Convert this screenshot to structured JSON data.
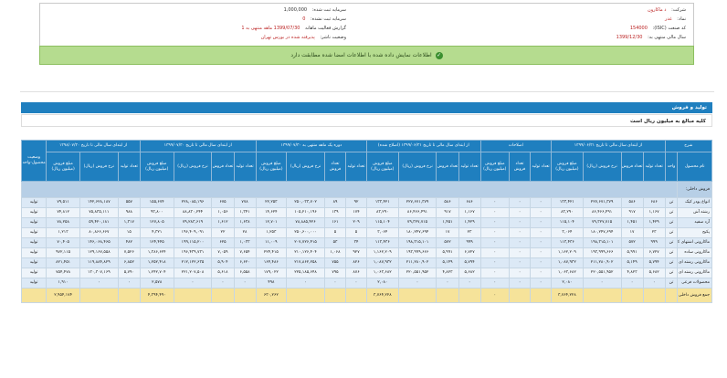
{
  "header": {
    "rows": [
      {
        "label": "شرکت:",
        "value": "ذ ماکارون",
        "red": true
      },
      {
        "label": "نماد:",
        "value": "غدر",
        "red": true
      },
      {
        "label": "کد صنعت (ISIC):",
        "value": "154000",
        "red": true
      },
      {
        "label": "سال مالی منتهی به:",
        "value": "1399/12/30",
        "red": false
      }
    ],
    "rows_left": [
      {
        "label": "سرمایه ثبت شده:",
        "value": "1,000,000"
      },
      {
        "label": "سرمایه ثبت نشده:",
        "value": "0"
      },
      {
        "label": "گزارش فعالیت ماهانه",
        "value": "1399/07/30 ماهه منتهی به 1"
      },
      {
        "label": "وضعیت ناشر:",
        "value": "پذیرفته شده در بورس تهران"
      }
    ]
  },
  "alert": {
    "text": "اطلاعات نمایش داده شده با اطلاعات امضا شده مطابقت دارد"
  },
  "section": {
    "title": "تولید و فروش"
  },
  "subtitle": {
    "text": "کلیه مبالغ به میلیون ریال است"
  },
  "table": {
    "group_headers": [
      "شرح",
      "از ابتدای سال مالی تا تاریخ ۱۳۹۹/۰۶/۳۱",
      "اصلاحات",
      "از ابتدای سال مالی تا تاریخ ۱۳۹۹/۰۶/۳۱ (اصلاح شده)",
      "دوره یک ماهه منتهی به ۱۳۹۹/۰۷/۳۰",
      "از ابتدای سال مالی تا تاریخ ۱۳۹۹/۰۷/۳۰",
      "از ابتدای سال مالی تا تاریخ ۱۳۹۸/۰۷/۳۰",
      "وضعیت محصول-واحد"
    ],
    "sub_headers": [
      "نام محصول",
      "واحد",
      "تعداد تولید",
      "تعداد فروش",
      "نرخ فروش (ریال)",
      "مبلغ فروش (میلیون ریال)",
      "تعداد تولید",
      "تعداد فروش",
      "مبلغ فروش (میلیون ریال)",
      "تعداد تولید",
      "تعداد فروش",
      "نرخ فروش (ریال)",
      "مبلغ فروش (میلیون ریال)",
      "تعداد تولید",
      "تعداد فروش",
      "نرخ فروش (ریال)",
      "مبلغ فروش (میلیون ریال)",
      "تعداد تولید",
      "تعداد فروش",
      "نرخ فروش (ریال)",
      "مبلغ فروش (میلیون ریال)",
      "تعداد تولید",
      "تعداد فروش",
      "نرخ فروش (ریال)",
      "مبلغ فروش (میلیون ریال)",
      ""
    ],
    "category": "فروش داخلی:",
    "rows": [
      [
        "انواع پودر کیک",
        "تن",
        "۶۸۶",
        "۵۸۶",
        "۲۲۷,۶۷۱,۳۷۹",
        "۱۳۳,۴۲۱",
        "۰",
        "۰",
        "۰",
        "۶۸۶",
        "۵۸۶",
        "۲۲۷,۶۷۱,۳۷۹",
        "۱۳۳,۴۲۱",
        "۹۲",
        "۸۹",
        "۲۵۰,۰۳۳,۷۰۲",
        "۲۲,۲۵۳",
        "۷۷۸",
        "۶۷۵",
        "۲۲۸,۰۸۵,۱۹۶",
        "۱۵۵,۶۷۴",
        "۵۵۷",
        "۱۴۲,۶۲۸,۱۸۷",
        "۷۹,۵۱۱",
        "تولید"
      ],
      [
        "رشته آش",
        "تن",
        "۱,۱۶۷",
        "۹۱۷",
        "۸۶,۴۶۶,۴۹۱",
        "۸۳,۲۹۰",
        "۰",
        "۰",
        "۰",
        "۱,۱۶۷",
        "۹۱۷",
        "۸۶,۴۶۶,۴۹۱",
        "۸۳,۲۹۰",
        "۱۷۴",
        "۱۳۹",
        "۱۰۵,۲۱۰,۱۹۶",
        "۱۴,۶۲۴",
        "۱,۳۴۱",
        "۱,۰۵۶",
        "۸۸,۸۳۰,۲۴۴",
        "۹۳,۸۰۰",
        "۹۸۸",
        "۷۵,۸۳۵,۱۱۱",
        "۷۴,۸۱۲",
        "تولید"
      ],
      [
        "آرد سفید",
        "تن",
        "۱,۴۲۹",
        "۱,۴۵۱",
        "۷۹,۳۲۷,۷۱۵",
        "۱۱۵,۱۰۴",
        "۰",
        "۰",
        "۰",
        "۱,۴۲۹",
        "۱,۴۵۱",
        "۷۹,۳۲۷,۷۱۵",
        "۱۱۵,۱۰۴",
        "۲۰۹",
        "۱۶۱",
        "۷۸,۸۸۵,۴۲۶",
        "۱۲,۷۰۱",
        "۱,۶۳۸",
        "۱,۶۱۲",
        "۷۹,۲۸۳,۶۱۹",
        "۱۲۷,۸۰۵",
        "۱,۳۱۷",
        "۵۹,۴۲۰,۱۸۱",
        "۷۸,۲۵۸",
        "تولید"
      ],
      [
        "پکیج",
        "تن",
        "۲۳",
        "۱۷",
        "۱۸۰,۲۴۷,۶۹۴",
        "۳,۰۶۴",
        "۰",
        "۰",
        "۰",
        "۲۳",
        "۱۷",
        "۱۸۰,۲۴۷,۶۹۴",
        "۳,۰۶۴",
        "۵",
        "۵",
        "۲۵۰,۶۰۰,۰۰۰",
        "۱,۲۵۳",
        "۲۸",
        "۲۲",
        "۱۹۶,۴۰۹,۰۹۱",
        "۴,۳۲۱",
        "۱۵",
        "۸۰,۸۶۶,۶۶۷",
        "۱,۲۱۳",
        "تولید"
      ],
      [
        "ماکارونی اشتهای کیک",
        "تن",
        "۹۹۹",
        "۵۷۲",
        "۱۹۸,۳۱۵,۱۰۱",
        "۱۱۳,۴۳۶",
        "۰",
        "۰",
        "۰",
        "۹۹۹",
        "۵۷۲",
        "۱۹۸,۳۱۵,۱۰۱",
        "۱۱۳,۴۳۶",
        "۳۴",
        "۵۳",
        "۲۰۷,۷۲۶,۴۱۵",
        "۱۱,۰۰۹",
        "۱,۰۳۳",
        "۶۲۵",
        "۱۹۹,۱۱۵,۲۰۰",
        "۱۲۴,۴۴۵",
        "۴۸۲",
        "۱۴۶,۰۶۸,۴۶۵",
        "۷۰,۴۰۵",
        "تولید"
      ],
      [
        "ماکارونی ساده",
        "تن",
        "۶,۷۲۷",
        "۵,۹۹۱",
        "۱۹۳,۹۹۹,۶۶۶",
        "۱,۱۶۲,۲۰۹",
        "۰",
        "۰",
        "۰",
        "۶,۷۲۷",
        "۵,۹۹۱",
        "۱۹۳,۹۹۹,۶۶۶",
        "۱,۱۶۲,۲۰۹",
        "۹۲۷",
        "۱,۰۶۸",
        "۲۱۰,۱۲۶,۴۰۴",
        "۲۲۴,۴۱۵",
        "۷,۶۵۴",
        "۷,۰۵۹",
        "۱۹۶,۴۳۹,۷۳۱",
        "۱,۳۸۶,۶۲۴",
        "۷,۵۲۶",
        "۱۲۹,۱۶۷,۵۵۸",
        "۹۷۲,۱۱۵",
        "تولید"
      ],
      [
        "ماکارونی رشته ای",
        "تن",
        "۵,۷۹۴",
        "۵,۱۴۹",
        "۲۱۱,۲۸۰,۹۰۲",
        "۱,۰۸۷,۹۳۲",
        "۰",
        "۰",
        "۰",
        "۵,۷۹۴",
        "۵,۱۴۹",
        "۲۱۱,۲۸۰,۹۰۲",
        "۱,۰۸۷,۹۳۲",
        "۸۲۶",
        "۷۵۵",
        "۲۱۷,۸۶۲,۲۵۸",
        "۱۶۴,۴۸۶",
        "۶,۶۲۰",
        "۵,۹۰۴",
        "۲۱۲,۱۲۲,۶۳۵",
        "۱,۲۵۲,۴۱۸",
        "۶,۸۵۲",
        "۱۱۹,۸۸۴,۸۲۹",
        "۸۲۱,۴۵۱",
        "تولید"
      ],
      [
        "ماکارونی رشته ای",
        "تن",
        "۵,۶۸۲",
        "۴,۸۲۳",
        "۲۲۰,۵۵۱,۹۵۲",
        "۱,۰۶۳,۶۸۲",
        "۰",
        "۰",
        "۰",
        "۵,۶۸۲",
        "۴,۸۲۳",
        "۲۲۰,۵۵۱,۹۵۲",
        "۱,۰۶۳,۶۸۲",
        "۸۷۶",
        "۷۹۵",
        "۲۲۵,۱۸۵,۶۴۸",
        "۱۷۹,۰۲۲",
        "۶,۵۵۸",
        "۵,۶۱۸",
        "۲۲۱,۲۰۷,۵۰۸",
        "۱,۲۴۲,۷۰۴",
        "۵,۷۹۰",
        "۱۳۰,۳۰۷,۱۶۹",
        "۷۵۴,۴۷۸",
        "تولید"
      ],
      [
        "محصولات فرعی",
        "تن",
        "۰",
        "۰",
        "۰",
        "۲,۰۸۰",
        "۰",
        "۰",
        "۰",
        "۰",
        "۰",
        "۰",
        "۲,۰۸۰",
        "۰",
        "۰",
        "۰",
        "۴۹۸",
        "۰",
        "۰",
        "۰",
        "۲,۵۷۸",
        "۰",
        "۰",
        "۱,۹۱۰",
        "تولید"
      ]
    ],
    "total": [
      "جمع فروش داخلی",
      "",
      "",
      "",
      "",
      "۳,۷۶۴,۲۲۸",
      "",
      "",
      "۰",
      "",
      "",
      "",
      "۳,۷۶۴,۲۲۸",
      "",
      "",
      "",
      "۶۳۰,۲۶۲",
      "",
      "",
      "",
      "۴,۳۹۴,۴۹۰",
      "",
      "",
      "۲,۹۵۴,۱۷۴",
      ""
    ]
  }
}
